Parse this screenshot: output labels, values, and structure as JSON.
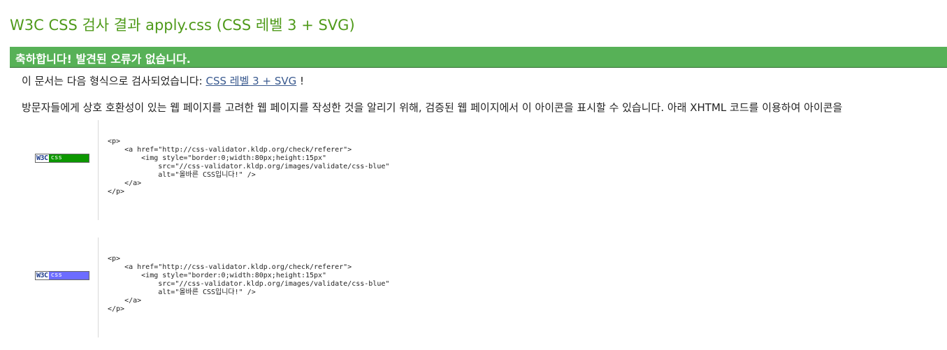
{
  "header": {
    "title": "W3C CSS 검사 결과 apply.css (CSS 레벨 3 + SVG)"
  },
  "result": {
    "congrats": "축하합니다! 발견된 오류가 없습니다."
  },
  "profile": {
    "prefix": "이 문서는 다음 형식으로 검사되었습니다:",
    "link": "CSS 레벨 3 + SVG",
    "suffix": "!"
  },
  "visitor_note": "방문자들에게 상호 호환성이 있는 웹 페이지를 고려한 웹 페이지를 작성한 것을 알리기 위해, 검증된 웹 페이지에서 이 아이콘을 표시할 수 있습니다. 아래 XHTML 코드를 이용하여 아이콘을",
  "badges": [
    {
      "w3c": "W3C",
      "css": "css",
      "color": "#0c9700",
      "code": "<p>\n    <a href=\"http://css-validator.kldp.org/check/referer\">\n        <img style=\"border:0;width:80px;height:15px\"\n            src=\"//css-validator.kldp.org/images/validate/css-blue\"\n            alt=\"올바른 CSS입니다!\" />\n    </a>\n</p>"
    },
    {
      "w3c": "W3C",
      "css": "css",
      "color": "#6c6cff",
      "code": "<p>\n    <a href=\"http://css-validator.kldp.org/check/referer\">\n        <img style=\"border:0;width:80px;height:15px\"\n            src=\"//css-validator.kldp.org/images/validate/css-blue\"\n            alt=\"올바른 CSS입니다!\" />\n    </a>\n</p>"
    }
  ]
}
